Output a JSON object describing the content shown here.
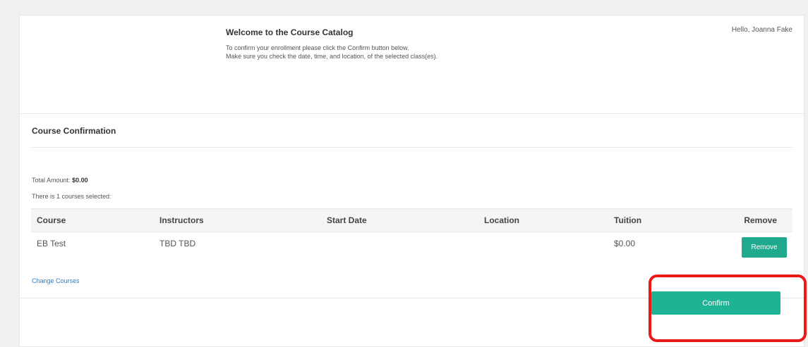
{
  "header": {
    "title": "Welcome to the Course Catalog",
    "line1": "To confirm your enrollment please click the Confirm button below.",
    "line2": "Make sure you check the date, time, and location, of the selected class(es).",
    "greeting": "Hello, Joanna Fake"
  },
  "confirmation": {
    "title": "Course Confirmation",
    "total_label": "Total Amount:",
    "total_value": "$0.00",
    "selected_text": "There is 1 courses selected:"
  },
  "table": {
    "headers": {
      "course": "Course",
      "instructors": "Instructors",
      "start_date": "Start Date",
      "location": "Location",
      "tuition": "Tuition",
      "remove": "Remove"
    },
    "rows": [
      {
        "course": "EB Test",
        "instructors": "TBD TBD",
        "start_date": "",
        "location": "",
        "tuition": "$0.00",
        "remove_label": "Remove"
      }
    ]
  },
  "actions": {
    "change_courses": "Change Courses",
    "confirm": "Confirm"
  },
  "colors": {
    "accent": "#1db394",
    "highlight": "#ea1a1a",
    "link": "#3a7cc0"
  }
}
